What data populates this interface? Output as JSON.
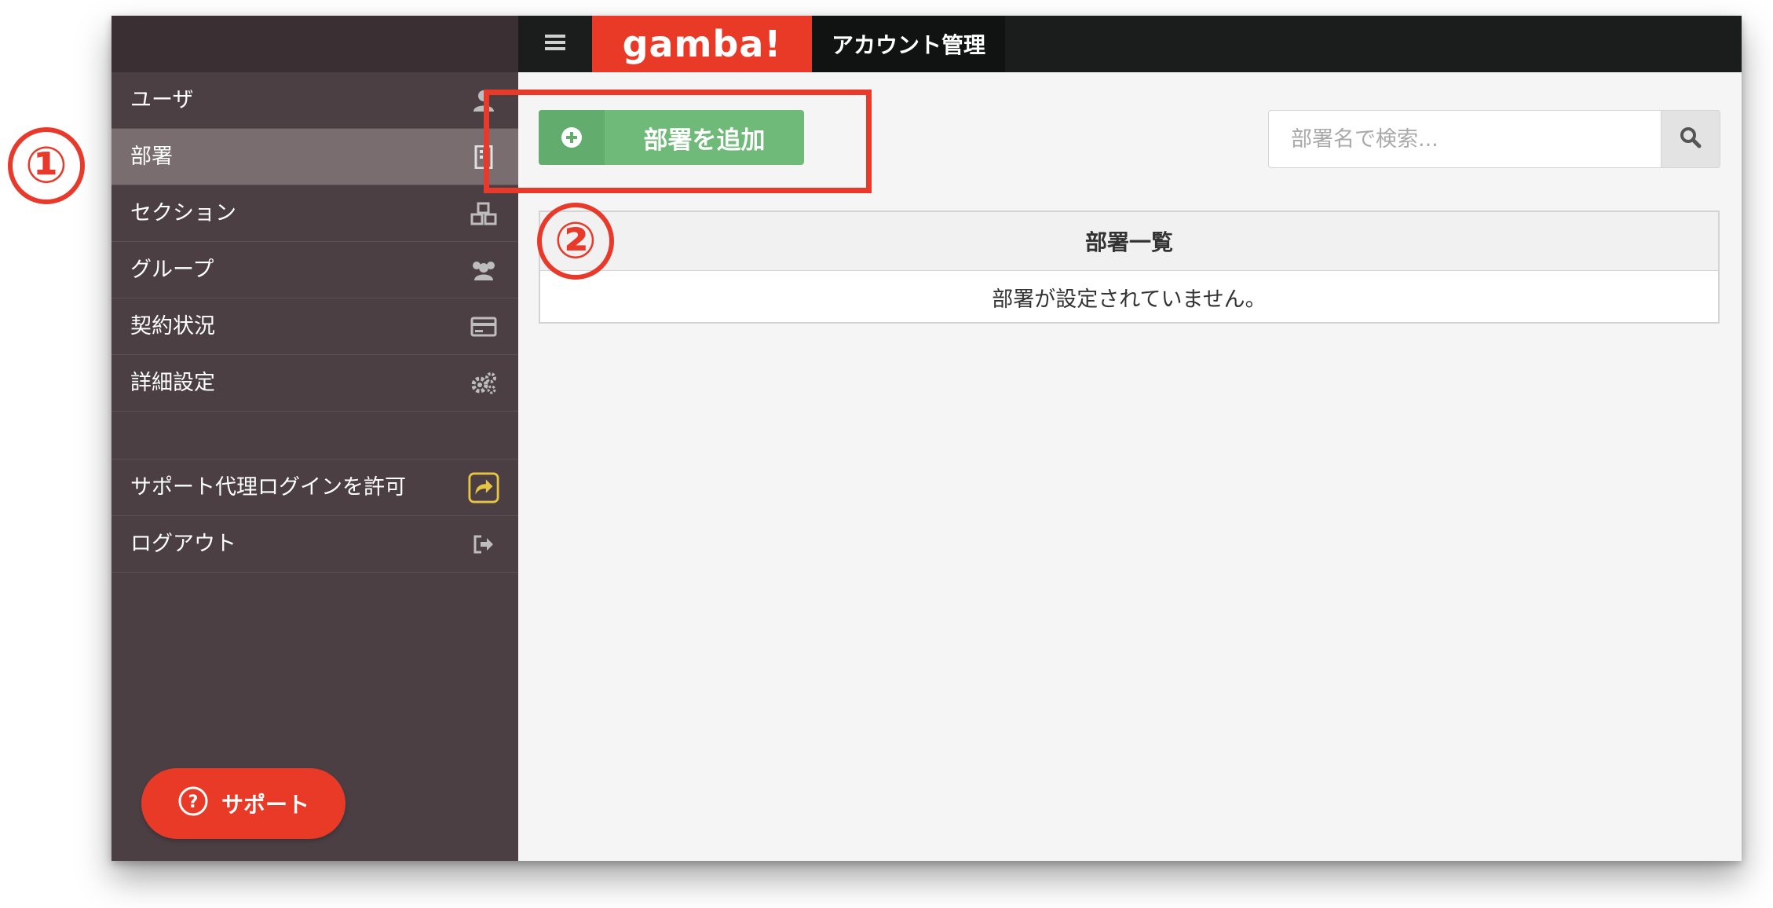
{
  "header": {
    "logo_text": "gamba!",
    "title": "アカウント管理",
    "menu_icon": "hamburger-icon"
  },
  "sidebar": {
    "items": [
      {
        "label": "ユーザ",
        "icon": "user-icon",
        "active": false
      },
      {
        "label": "部署",
        "icon": "building-icon",
        "active": true
      },
      {
        "label": "セクション",
        "icon": "cubes-icon",
        "active": false
      },
      {
        "label": "グループ",
        "icon": "users-icon",
        "active": false
      },
      {
        "label": "契約状況",
        "icon": "credit-card-icon",
        "active": false
      },
      {
        "label": "詳細設定",
        "icon": "gears-icon",
        "active": false
      }
    ],
    "secondary_items": [
      {
        "label": "サポート代理ログインを許可",
        "icon": "share-icon"
      },
      {
        "label": "ログアウト",
        "icon": "sign-out-icon"
      }
    ],
    "support_button": {
      "label": "サポート",
      "icon": "question-circle-icon"
    }
  },
  "main": {
    "add_button_label": "部署を追加",
    "search_placeholder": "部署名で検索...",
    "department_panel": {
      "title": "部署一覧",
      "empty_message": "部署が設定されていません。"
    }
  },
  "annotations": {
    "step1": "①",
    "step2": "②"
  },
  "colors": {
    "brand_red": "#e83a26",
    "sidebar_bg": "#4b3f43",
    "sidebar_active": "#7a6d70",
    "add_button_green": "#6fb979",
    "share_icon_yellow": "#e7c544",
    "annotation_red": "#e8392a"
  }
}
